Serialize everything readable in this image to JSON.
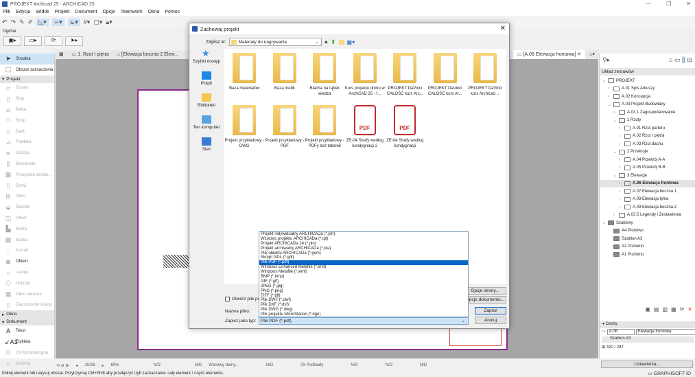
{
  "window": {
    "title": "PROJEKT Archicad 25 - ARCHICAD 25",
    "minimize": "—",
    "maximize": "❐",
    "close": "✕"
  },
  "menu": [
    "Plik",
    "Edycja",
    "Widok",
    "Projekt",
    "Dokument",
    "Opcje",
    "Teamwork",
    "Okna",
    "Pomoc"
  ],
  "toolbox_label": "Ogólne",
  "tabs": [
    {
      "label": "1. Rzut I piętra"
    },
    {
      "label": "[Elewacja boczna 2 Elew..."
    },
    {
      "label": "[A.06 Elewacja frontowa]"
    }
  ],
  "left_panel": {
    "top": [
      {
        "label": "Strzałka",
        "icon": "arrow-icon"
      },
      {
        "label": "Obszar zaznaczenia",
        "icon": "marquee-icon"
      }
    ],
    "section_projekt": "Projekt",
    "projekt_items": [
      "Ściana",
      "Słup",
      "Belka",
      "Strop",
      "Dach",
      "Powłoka",
      "Schody",
      "Balustrada",
      "Przegroda struktu...",
      "Drzwi",
      "Okno",
      "Świetlik",
      "Otwór",
      "Strefa",
      "Siatka",
      "Kształt",
      "Obiekt",
      "Lampa",
      "Osprzęt",
      "Okno narożne",
      "Zakończenie ściany"
    ],
    "section_okno": "Okno",
    "section_dokument": "Dokument",
    "dokument_items": [
      "Tekst",
      "Etykieta",
      "Oś Konstrukcyjna",
      "Korekta"
    ]
  },
  "dialog": {
    "title": "Zachowaj projekt",
    "save_in_label": "Zapisz w:",
    "save_in_value": "Materiały do nagrywania",
    "places": [
      "Szybki dostęp",
      "Pulpit",
      "Biblioteki",
      "Ten komputer",
      "Sieć"
    ],
    "files": [
      {
        "name": "Baza materiałów",
        "type": "folder"
      },
      {
        "name": "Baza mebli",
        "type": "folder"
      },
      {
        "name": "Blacha na rąbek wiedza",
        "type": "folder"
      },
      {
        "name": "Kurs projektu domu w ArchiCAD 25 - f...",
        "type": "folder"
      },
      {
        "name": "PROJEKT DaVinci CAŁOŚĆ kurs Arc...",
        "type": "folder"
      },
      {
        "name": "PROJEKT DaVinci CAŁOŚĆ kurs Ar...",
        "type": "folder"
      },
      {
        "name": "PROJEKT DaVinci kurs Archicad ...",
        "type": "folder"
      },
      {
        "name": "Projekt przykładowy - DWG",
        "type": "folder"
      },
      {
        "name": "Projekt przykładowy - PDF",
        "type": "folder"
      },
      {
        "name": "Projekt przykładowy - PDFy bez tabelek",
        "type": "folder"
      },
      {
        "name": "ZE-04 Strefy według kondygnacji 2",
        "type": "pdf"
      },
      {
        "name": "ZE-04 Strefy według kondygnacji",
        "type": "pdf"
      }
    ],
    "pdf_label": "PDF",
    "open_after": "Otwórz plik po",
    "page_options": "Opcje strony...",
    "doc_options": "Opcje dokumentu...",
    "filename_label": "Nazwa pliku:",
    "filetype_label": "Zapisz jako typ:",
    "filetype_value": "Plik PDF (*.pdf)",
    "save": "Zapisz",
    "cancel": "Anuluj",
    "filetype_options": [
      "Projekt indywidualny ARCHICADa (*.pln)",
      "Wzorzec projektu ARCHICADa (*.tpl)",
      "Projekt ARCHICADa 24 (*.pln)",
      "Projekt archiwalny ARCHICADa (*.pla)",
      "Plik obiektu ARCHICADa (*.gsm)",
      "Skrypt GDL (*.gdl)",
      "Plik PDF (*.pdf)",
      "Windows Enhanced Metafile (*.emf)",
      "Windows Metafile (*.wmf)",
      "BMP (*.bmp)",
      "GIF (*.gif)",
      "JPEG (*.jpg)",
      "PNG (*.png)",
      "TIFF (*.tiff)",
      "Plik DWF (*.dwf)",
      "Plik DXF (*.dxf)",
      "Plik DWG (*.dwg)",
      "Plik projektu MicroStation (*.dgn)"
    ],
    "selected_option": 6
  },
  "right_panel": {
    "header": "Układ zestawów",
    "tree": [
      {
        "label": "PROJEKT",
        "level": 0,
        "exp": "v"
      },
      {
        "label": "A.01 Spis Arkuszy",
        "level": 1,
        "exp": ">"
      },
      {
        "label": "A.02 Koncepcja",
        "level": 1,
        "exp": ">"
      },
      {
        "label": "A.03 Projekt Budowlany",
        "level": 1,
        "exp": "v"
      },
      {
        "label": "A.03.1 Zagospodarowanie",
        "level": 2,
        "exp": ">"
      },
      {
        "label": "1 Rzuty",
        "level": 2,
        "exp": "v"
      },
      {
        "label": "A.01 Rzut parteru",
        "level": 3,
        "exp": ">"
      },
      {
        "label": "A.02 Rzut I piętra",
        "level": 3,
        "exp": ">"
      },
      {
        "label": "A.03 Rzut dachu",
        "level": 3,
        "exp": ">"
      },
      {
        "label": "2 Przekroje",
        "level": 2,
        "exp": "v"
      },
      {
        "label": "A.04 Przekrój A-A",
        "level": 3,
        "exp": ">"
      },
      {
        "label": "A.05 Przekrój B-B",
        "level": 3,
        "exp": ">"
      },
      {
        "label": "3 Elewacje",
        "level": 2,
        "exp": "v"
      },
      {
        "label": "A.06 Elewacja frontowa",
        "level": 3,
        "exp": ">",
        "selected": true
      },
      {
        "label": "A.07 Elewacja boczna 1",
        "level": 3,
        "exp": ">"
      },
      {
        "label": "A.08 Elewacja tylna",
        "level": 3,
        "exp": ">"
      },
      {
        "label": "A.09 Elewacja boczna 2",
        "level": 3,
        "exp": ">"
      },
      {
        "label": "A.03.5 Legendy i Zestawienia",
        "level": 2,
        "exp": ">"
      },
      {
        "label": "Szablony",
        "level": 0,
        "exp": "v"
      },
      {
        "label": "A4 Pionowo",
        "level": 1,
        "exp": ""
      },
      {
        "label": "Szablon A3",
        "level": 1,
        "exp": ""
      },
      {
        "label": "A2 Poziomo",
        "level": 1,
        "exp": ""
      },
      {
        "label": "A1 Poziomo",
        "level": 1,
        "exp": ""
      }
    ],
    "cechy": "Cechy",
    "id_value": "A.06",
    "name_value": "Elewacja frontowa",
    "template_value": "Szablon A3",
    "size": "420 / 297",
    "settings": "Ustawienia..."
  },
  "navbar": {
    "page": "20/26",
    "zoom": "60%",
    "nd": "N/D",
    "layers": "Warstwy domy...",
    "story": "03 Podkłady"
  },
  "status": "Kliknij element lub narysuj obszar. Przytrzymaj Ctrl+Shift aby przełączyć tryb zaznaczania: cały element / część elementu.",
  "graphisoft": "GRAPHISOFT ID"
}
